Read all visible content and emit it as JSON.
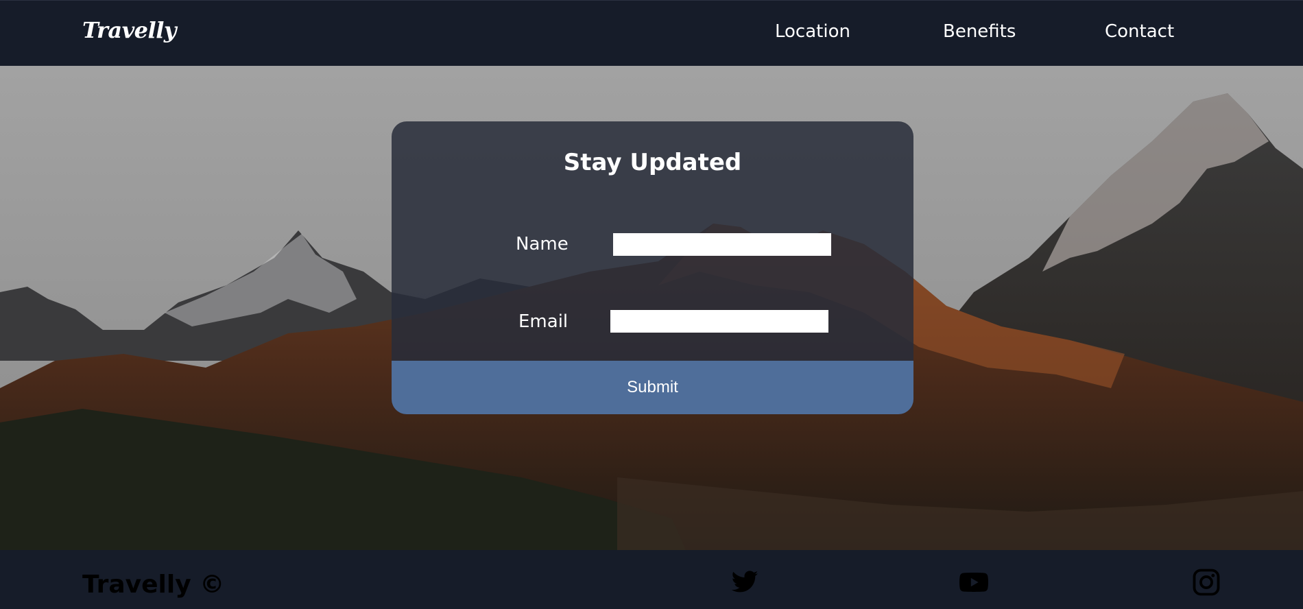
{
  "header": {
    "logo": "Travelly",
    "nav": {
      "location": "Location",
      "benefits": "Benefits",
      "contact": "Contact"
    }
  },
  "form": {
    "title": "Stay Updated",
    "name_label": "Name",
    "email_label": "Email",
    "name_value": "",
    "email_value": "",
    "submit_label": "Submit"
  },
  "footer": {
    "brand": "Travelly ©",
    "social": [
      "twitter-icon",
      "youtube-icon",
      "instagram-icon"
    ]
  },
  "colors": {
    "header_bg": "#161c29",
    "card_bg": "#2c313d",
    "submit_bg": "#4f6e9a",
    "text": "#ffffff"
  }
}
